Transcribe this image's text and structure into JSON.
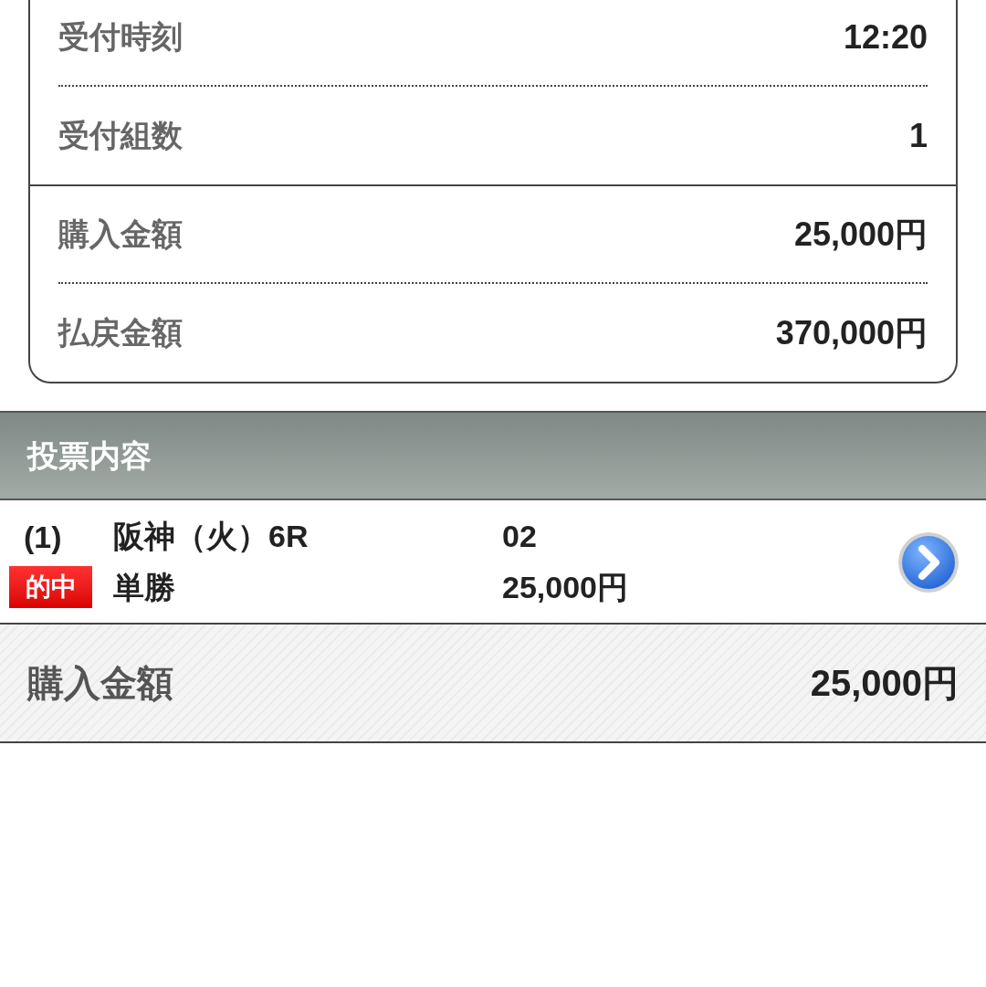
{
  "summary": {
    "groups": [
      [
        {
          "label": "受付時刻",
          "value": "12:20"
        },
        {
          "label": "受付組数",
          "value": "1"
        }
      ],
      [
        {
          "label": "購入金額",
          "value": "25,000円"
        },
        {
          "label": "払戻金額",
          "value": "370,000円"
        }
      ]
    ]
  },
  "ticket": {
    "section_title": "投票内容",
    "bets": [
      {
        "number": "(1)",
        "hit": true,
        "hit_label": "的中",
        "race": "阪神（火）6R",
        "selection": "02",
        "bet_type": "単勝",
        "amount": "25,000円"
      }
    ]
  },
  "total": {
    "label": "購入金額",
    "value": "25,000円"
  }
}
